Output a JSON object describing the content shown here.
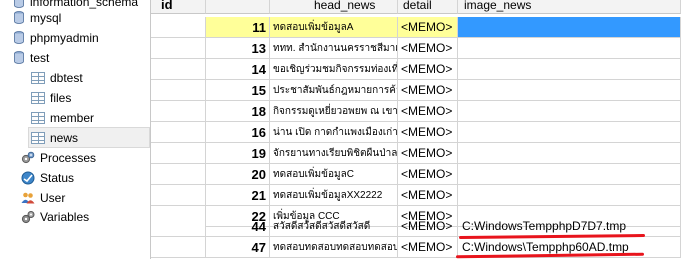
{
  "tree": {
    "items": [
      {
        "label": "information_schema",
        "kind": "db"
      },
      {
        "label": "mysql",
        "kind": "db"
      },
      {
        "label": "phpmyadmin",
        "kind": "db"
      },
      {
        "label": "test",
        "kind": "db"
      },
      {
        "label": "dbtest",
        "kind": "table"
      },
      {
        "label": "files",
        "kind": "table"
      },
      {
        "label": "member",
        "kind": "table"
      },
      {
        "label": "news",
        "kind": "table",
        "selected": true
      }
    ],
    "tools": [
      {
        "label": "Processes",
        "icon": "gears-icon"
      },
      {
        "label": "Status",
        "icon": "status-icon"
      },
      {
        "label": "User",
        "icon": "users-icon"
      },
      {
        "label": "Variables",
        "icon": "variables-icon"
      }
    ]
  },
  "grid": {
    "columns": [
      "id",
      "head_news",
      "detail",
      "image_news"
    ],
    "rows": [
      {
        "id": "11",
        "head_news": "ทดสอบเพิ่มข้อมูลA",
        "detail": "<MEMO>",
        "image_news": ""
      },
      {
        "id": "13",
        "head_news": "ททท. สำนักงานนครราชสีมาเชิญ",
        "detail": "<MEMO>",
        "image_news": ""
      },
      {
        "id": "14",
        "head_news": "ขอเชิญร่วมชมกิจกรรมท่องเที่ยว",
        "detail": "<MEMO>",
        "image_news": ""
      },
      {
        "id": "15",
        "head_news": "ประชาสัมพันธ์กฎหมายการค้างาช",
        "detail": "<MEMO>",
        "image_news": ""
      },
      {
        "id": "18",
        "head_news": "กิจกรรมดูเหยี่ยวอพยพ ณ เขาเรด",
        "detail": "<MEMO>",
        "image_news": ""
      },
      {
        "id": "16",
        "head_news": "น่าน เปิด กาดกำแพงเมืองเก่า ข",
        "detail": "<MEMO>",
        "image_news": ""
      },
      {
        "id": "19",
        "head_news": "จักรยานทางเรียบพิชิตผืนป่าลพ",
        "detail": "<MEMO>",
        "image_news": ""
      },
      {
        "id": "20",
        "head_news": "ทดสอบเพิ่มข้อมูลC",
        "detail": "<MEMO>",
        "image_news": ""
      },
      {
        "id": "21",
        "head_news": "ทดสอบเพิ่มข้อมูลXX2222",
        "detail": "<MEMO>",
        "image_news": ""
      },
      {
        "id": "22",
        "head_news": "เพิ่มข้อมูล CCC",
        "detail": "<MEMO>",
        "image_news": ""
      },
      {
        "id": "44",
        "head_news": "สวัสดีสวัสดีสวัสดีสวัสดี",
        "detail": "<MEMO>",
        "image_news": "C:WindowsTempphpD7D7.tmp"
      },
      {
        "id": "47",
        "head_news": "ทดสอบทดสอบทดสอบทดสอบทดส",
        "detail": "<MEMO>",
        "image_news": "C:Windows\\Tempphp60AD.tmp"
      }
    ]
  },
  "colors": {
    "selected_row": "#ffff99",
    "selected_cell": "#3399ff",
    "annotation": "#e8141c"
  }
}
